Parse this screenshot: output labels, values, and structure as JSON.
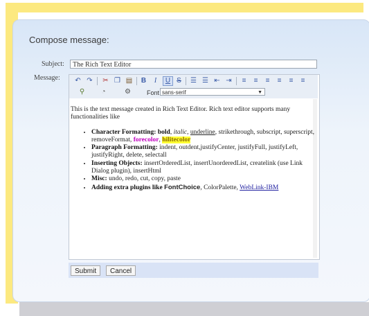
{
  "page": {
    "title": "Compose message:"
  },
  "form": {
    "subject_label": "Subject:",
    "subject_value": "The Rich Text Editor",
    "message_label": "Message:"
  },
  "toolbar": {
    "icons": [
      "undo-icon",
      "redo-icon",
      "cut-icon",
      "copy-icon",
      "paste-icon",
      "bold-icon",
      "italic-icon",
      "underline-icon",
      "strikethrough-icon",
      "ordered-list-icon",
      "unordered-list-icon",
      "outdent-icon",
      "indent-icon",
      "justify-left-icon",
      "justify-center-icon",
      "justify-right-icon",
      "justify-full-icon",
      "remove-format-icon",
      "link-icon",
      "image-icon"
    ],
    "font_label": "Font",
    "font_value": "sans-serif"
  },
  "content": {
    "intro": "This is the text message created in Rich Text Editor. Rich text editor supports many functionalities like",
    "items": [
      {
        "heading": "Character Formatting:",
        "bold": "bold",
        "italic": "italic",
        "underline": "underline",
        "rest": "strikethrough, subscript, superscript, removeFormat,",
        "forecolor": "forecolor",
        "hilitecolor": "hilitecolor"
      },
      {
        "heading": "Paragraph Formatting:",
        "text": "indent, outdent,justifyCenter, justifyFull, justifyLeft, justifyRight, delete, selectall"
      },
      {
        "heading": "Inserting Objects:",
        "text": "insertOrderedList, insertUnorderedList, createlink (use Link Dialog plugin), insertHtml"
      },
      {
        "heading": "Misc:",
        "text": "undo, redo, cut, copy, paste"
      },
      {
        "heading": "Adding extra plugins like",
        "font_choice": "FontChoice",
        "mid": ", ColorPalette,",
        "link": "WebLink-IBM"
      }
    ]
  },
  "buttons": {
    "submit": "Submit",
    "cancel": "Cancel"
  }
}
